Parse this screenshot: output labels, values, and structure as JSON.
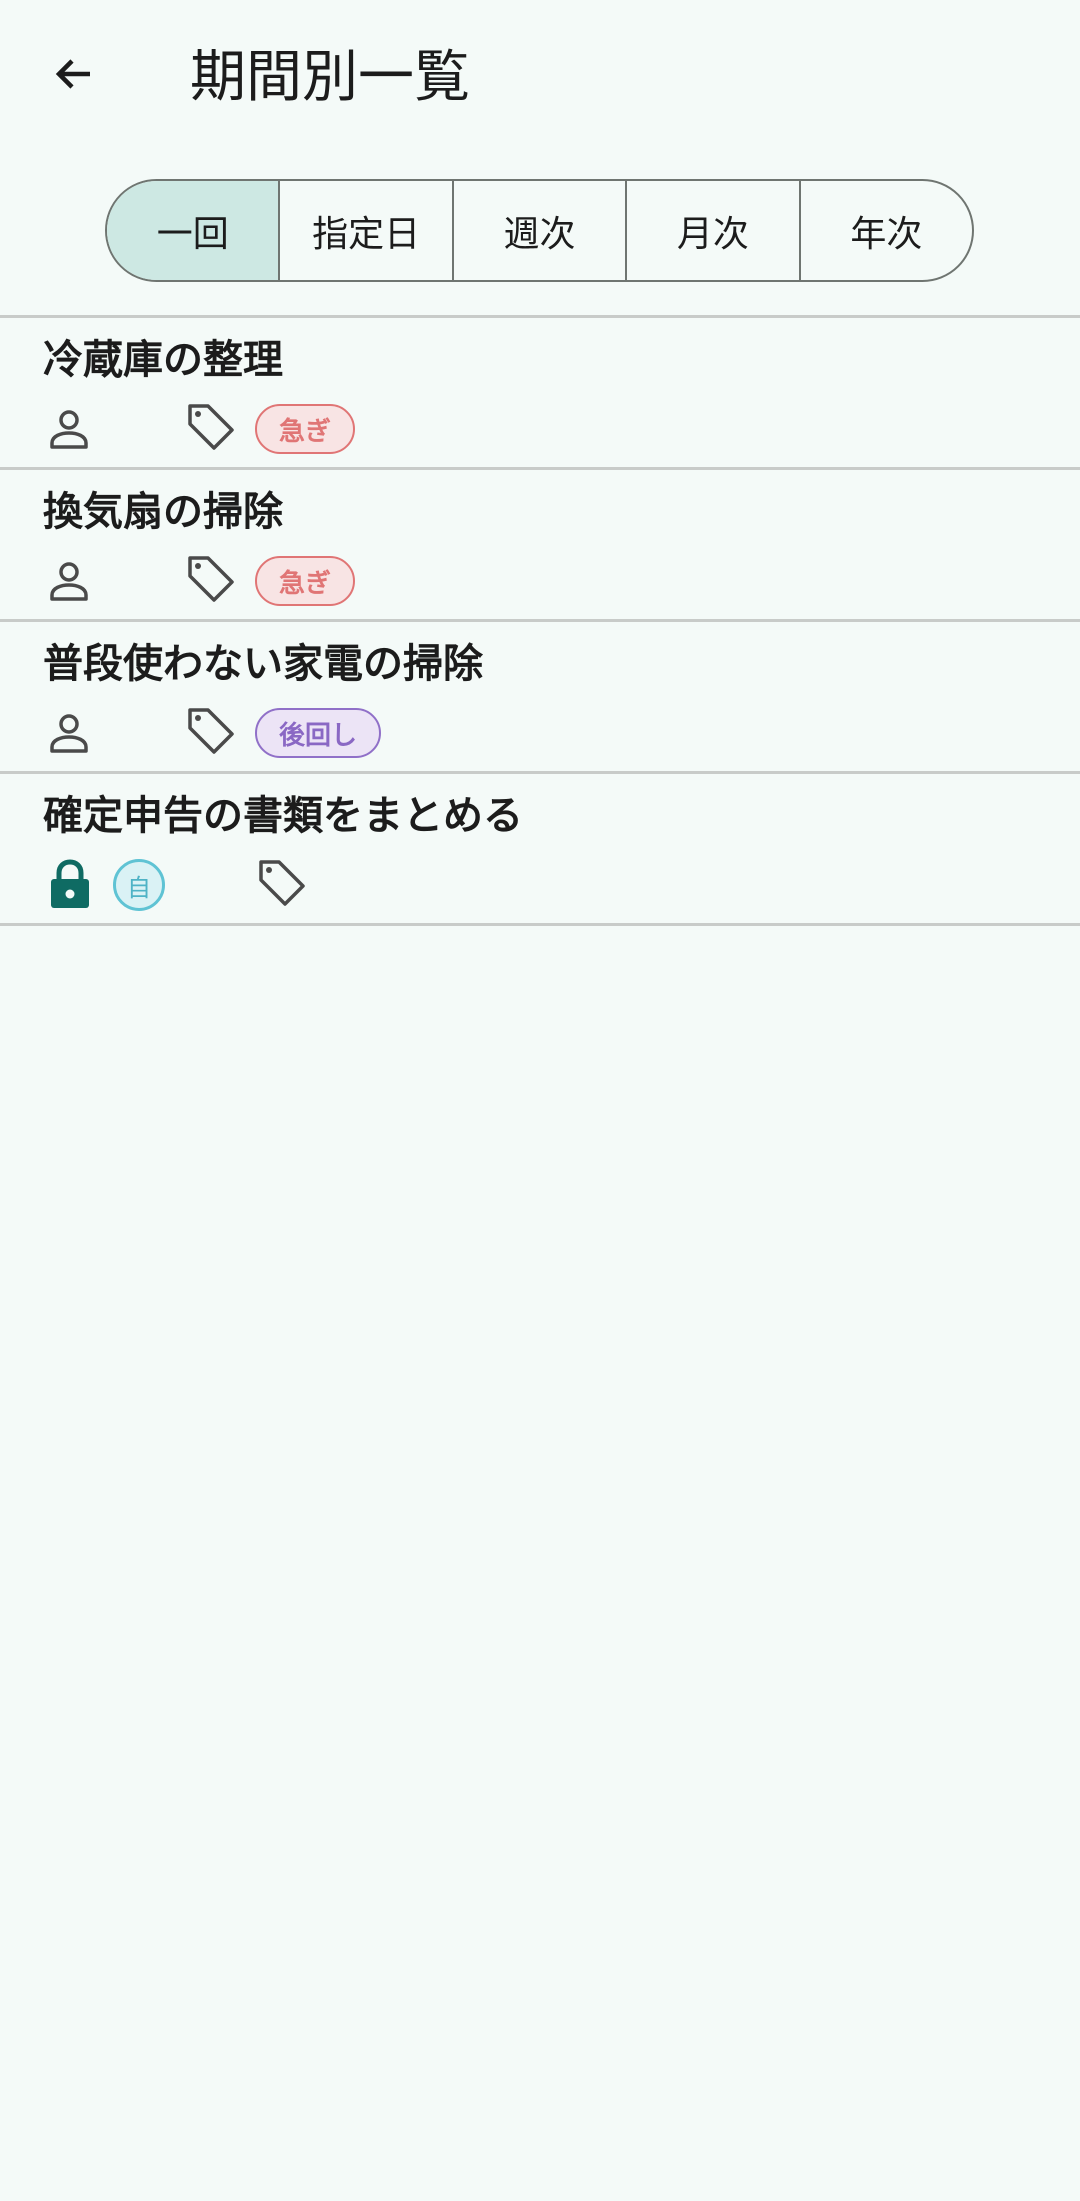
{
  "header": {
    "title": "期間別一覧",
    "back_icon": "arrow-left-icon"
  },
  "tabs": [
    {
      "label": "一回",
      "selected": true
    },
    {
      "label": "指定日",
      "selected": false
    },
    {
      "label": "週次",
      "selected": false
    },
    {
      "label": "月次",
      "selected": false
    },
    {
      "label": "年次",
      "selected": false
    }
  ],
  "tasks": [
    {
      "title": "冷蔵庫の整理",
      "assignee_icon": "person-icon",
      "tag_icon": "tag-icon",
      "tag": "急ぎ",
      "tag_color": "#e07575"
    },
    {
      "title": "換気扇の掃除",
      "assignee_icon": "person-icon",
      "tag_icon": "tag-icon",
      "tag": "急ぎ",
      "tag_color": "#e07575"
    },
    {
      "title": "普段使わない家電の掃除",
      "assignee_icon": "person-icon",
      "tag_icon": "tag-icon",
      "tag": "後回し",
      "tag_color": "#8a68c4"
    },
    {
      "title": "確定申告の書類をまとめる",
      "lock_icon": "lock-icon",
      "assignee_badge": "自",
      "tag_icon": "tag-icon"
    }
  ],
  "colors": {
    "background": "#f4faf8",
    "selected_tab": "#cde8e3",
    "lock": "#0f6b63",
    "self_badge": "#5fc3d4"
  }
}
